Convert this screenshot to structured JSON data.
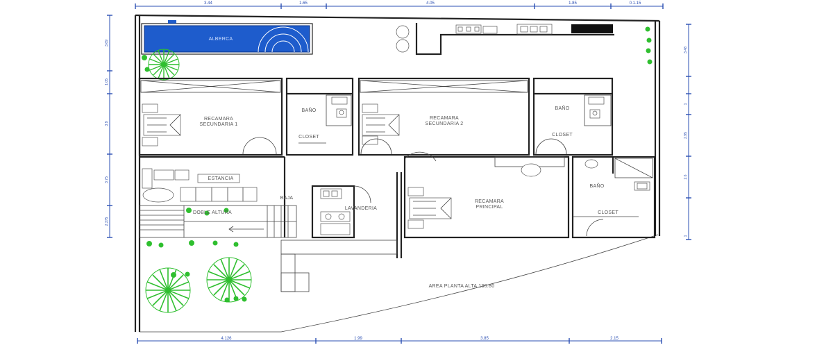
{
  "rooms": {
    "pool": "ALBERCA",
    "bedroom1": [
      "RECAMARA",
      "SECUNDARIA 1"
    ],
    "bath1": "BAÑO",
    "closet1": "CLOSET",
    "bedroom2": [
      "RECAMARA",
      "SECUNDARIA 2"
    ],
    "bath2": "BAÑO",
    "closet2": "CLOSET",
    "living": "ESTANCIA",
    "stairs_down": "BAJA",
    "stairs_note": "DOBLE ALTURA",
    "laundry": "LAVANDERIA",
    "master": [
      "RECAMARA",
      "PRINCIPAL"
    ],
    "bath3": "BAÑO",
    "closet3": "CLOSET",
    "area": "AREA PLANTA ALTA 130.80"
  },
  "dimensions": {
    "top": [
      "3.44",
      "1.65",
      "4.05",
      "1.85",
      "0.1.15"
    ],
    "bottom": [
      "4.126",
      "1.99",
      "3.85",
      "2.15"
    ],
    "left": [
      "3.69",
      "1.05",
      "3.9",
      "3.75",
      "2.375"
    ],
    "right": [
      "3.48",
      "1",
      "2.95",
      "2.6",
      "1"
    ]
  },
  "colors": {
    "pool": "#1e5ccc",
    "plants": "#2fbf2f",
    "dimension_lines": "#2b4fb3",
    "walls": "#222222"
  }
}
